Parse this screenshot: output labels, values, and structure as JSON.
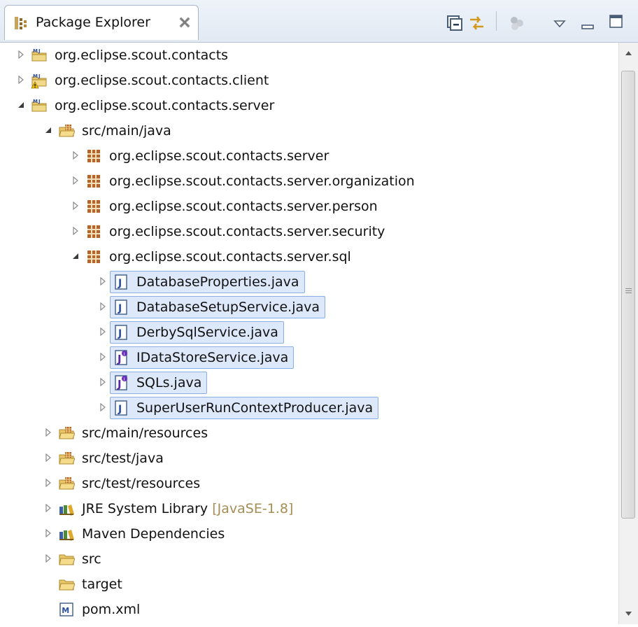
{
  "view": {
    "title": "Package Explorer",
    "tab_icon": "package-explorer-icon",
    "close_icon": "close-icon"
  },
  "toolbar": [
    {
      "name": "collapse-all-button",
      "icon": "collapse-all-icon"
    },
    {
      "name": "link-with-editor-button",
      "icon": "link-with-editor-icon"
    },
    {
      "name": "focus-on-active-task-button",
      "icon": "focus-task-icon"
    },
    {
      "name": "view-menu-button",
      "icon": "view-menu-icon"
    },
    {
      "name": "minimize-button",
      "icon": "minimize-icon"
    },
    {
      "name": "maximize-button",
      "icon": "maximize-icon"
    }
  ],
  "tree": [
    {
      "label": "org.eclipse.scout.contacts",
      "level": 0,
      "expander": "collapsed",
      "icon": "maven-project-icon"
    },
    {
      "label": "org.eclipse.scout.contacts.client",
      "level": 0,
      "expander": "collapsed",
      "icon": "maven-project-warning-icon"
    },
    {
      "label": "org.eclipse.scout.contacts.server",
      "level": 0,
      "expander": "expanded",
      "icon": "maven-project-icon"
    },
    {
      "label": "src/main/java",
      "level": 1,
      "expander": "expanded",
      "icon": "source-folder-icon"
    },
    {
      "label": "org.eclipse.scout.contacts.server",
      "level": 2,
      "expander": "collapsed",
      "icon": "package-icon"
    },
    {
      "label": "org.eclipse.scout.contacts.server.organization",
      "level": 2,
      "expander": "collapsed",
      "icon": "package-icon"
    },
    {
      "label": "org.eclipse.scout.contacts.server.person",
      "level": 2,
      "expander": "collapsed",
      "icon": "package-icon"
    },
    {
      "label": "org.eclipse.scout.contacts.server.security",
      "level": 2,
      "expander": "collapsed",
      "icon": "package-icon"
    },
    {
      "label": "org.eclipse.scout.contacts.server.sql",
      "level": 2,
      "expander": "expanded",
      "icon": "package-icon"
    },
    {
      "label": "DatabaseProperties.java",
      "level": 3,
      "expander": "collapsed",
      "icon": "java-class-file-icon",
      "selected": true
    },
    {
      "label": "DatabaseSetupService.java",
      "level": 3,
      "expander": "collapsed",
      "icon": "java-class-file-icon",
      "selected": true
    },
    {
      "label": "DerbySqlService.java",
      "level": 3,
      "expander": "collapsed",
      "icon": "java-class-file-icon",
      "selected": true
    },
    {
      "label": "IDataStoreService.java",
      "level": 3,
      "expander": "collapsed",
      "icon": "java-interface-file-icon",
      "selected": true
    },
    {
      "label": "SQLs.java",
      "level": 3,
      "expander": "collapsed",
      "icon": "java-interface-file-icon",
      "selected": true
    },
    {
      "label": "SuperUserRunContextProducer.java",
      "level": 3,
      "expander": "collapsed",
      "icon": "java-class-file-icon",
      "selected": true
    },
    {
      "label": "src/main/resources",
      "level": 1,
      "expander": "collapsed",
      "icon": "source-folder-icon"
    },
    {
      "label": "src/test/java",
      "level": 1,
      "expander": "collapsed",
      "icon": "source-folder-icon"
    },
    {
      "label": "src/test/resources",
      "level": 1,
      "expander": "collapsed",
      "icon": "source-folder-icon"
    },
    {
      "label": "JRE System Library",
      "decoration": "[JavaSE-1.8]",
      "level": 1,
      "expander": "collapsed",
      "icon": "library-icon"
    },
    {
      "label": "Maven Dependencies",
      "level": 1,
      "expander": "collapsed",
      "icon": "library-icon"
    },
    {
      "label": "src",
      "level": 1,
      "expander": "collapsed",
      "icon": "folder-icon"
    },
    {
      "label": "target",
      "level": 1,
      "expander": "none",
      "icon": "folder-icon"
    },
    {
      "label": "pom.xml",
      "level": 1,
      "expander": "none",
      "icon": "maven-pom-icon"
    }
  ],
  "colors": {
    "selection_fill": "#dde9fb",
    "selection_border": "#89aee3",
    "decoration_text": "#a58d56",
    "package_icon": "#a0522d",
    "folder_icon": "#e8c76a"
  }
}
